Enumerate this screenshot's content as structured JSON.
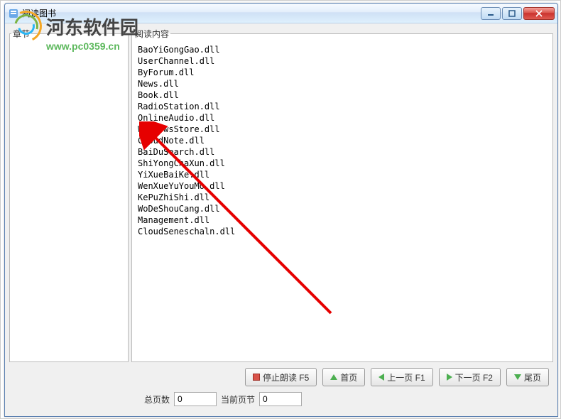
{
  "window": {
    "title": "阅读图书"
  },
  "panels": {
    "left_label": "章节",
    "right_label": "阅读内容"
  },
  "files": [
    "BaoYiGongGao.dll",
    "UserChannel.dll",
    "ByForum.dll",
    "News.dll",
    "Book.dll",
    "RadioStation.dll",
    "OnlineAudio.dll",
    "WindowsStore.dll",
    "CloudNote.dll",
    "BaiDuSearch.dll",
    "ShiYongChaXun.dll",
    "YiXueBaiKe.dll",
    "WenXueYuYouMo.dll",
    "KePuZhiShi.dll",
    "WoDeShouCang.dll",
    "Management.dll",
    "CloudSeneschaln.dll"
  ],
  "buttons": {
    "stop": "停止朗读 F5",
    "first": "首页",
    "prev": "上一页 F1",
    "next": "下一页 F2",
    "last": "尾页"
  },
  "status": {
    "total_label": "总页数",
    "total_value": "0",
    "current_label": "当前页节",
    "current_value": "0"
  },
  "watermark": {
    "brand": "河东软件园",
    "url": "www.pc0359.cn"
  }
}
